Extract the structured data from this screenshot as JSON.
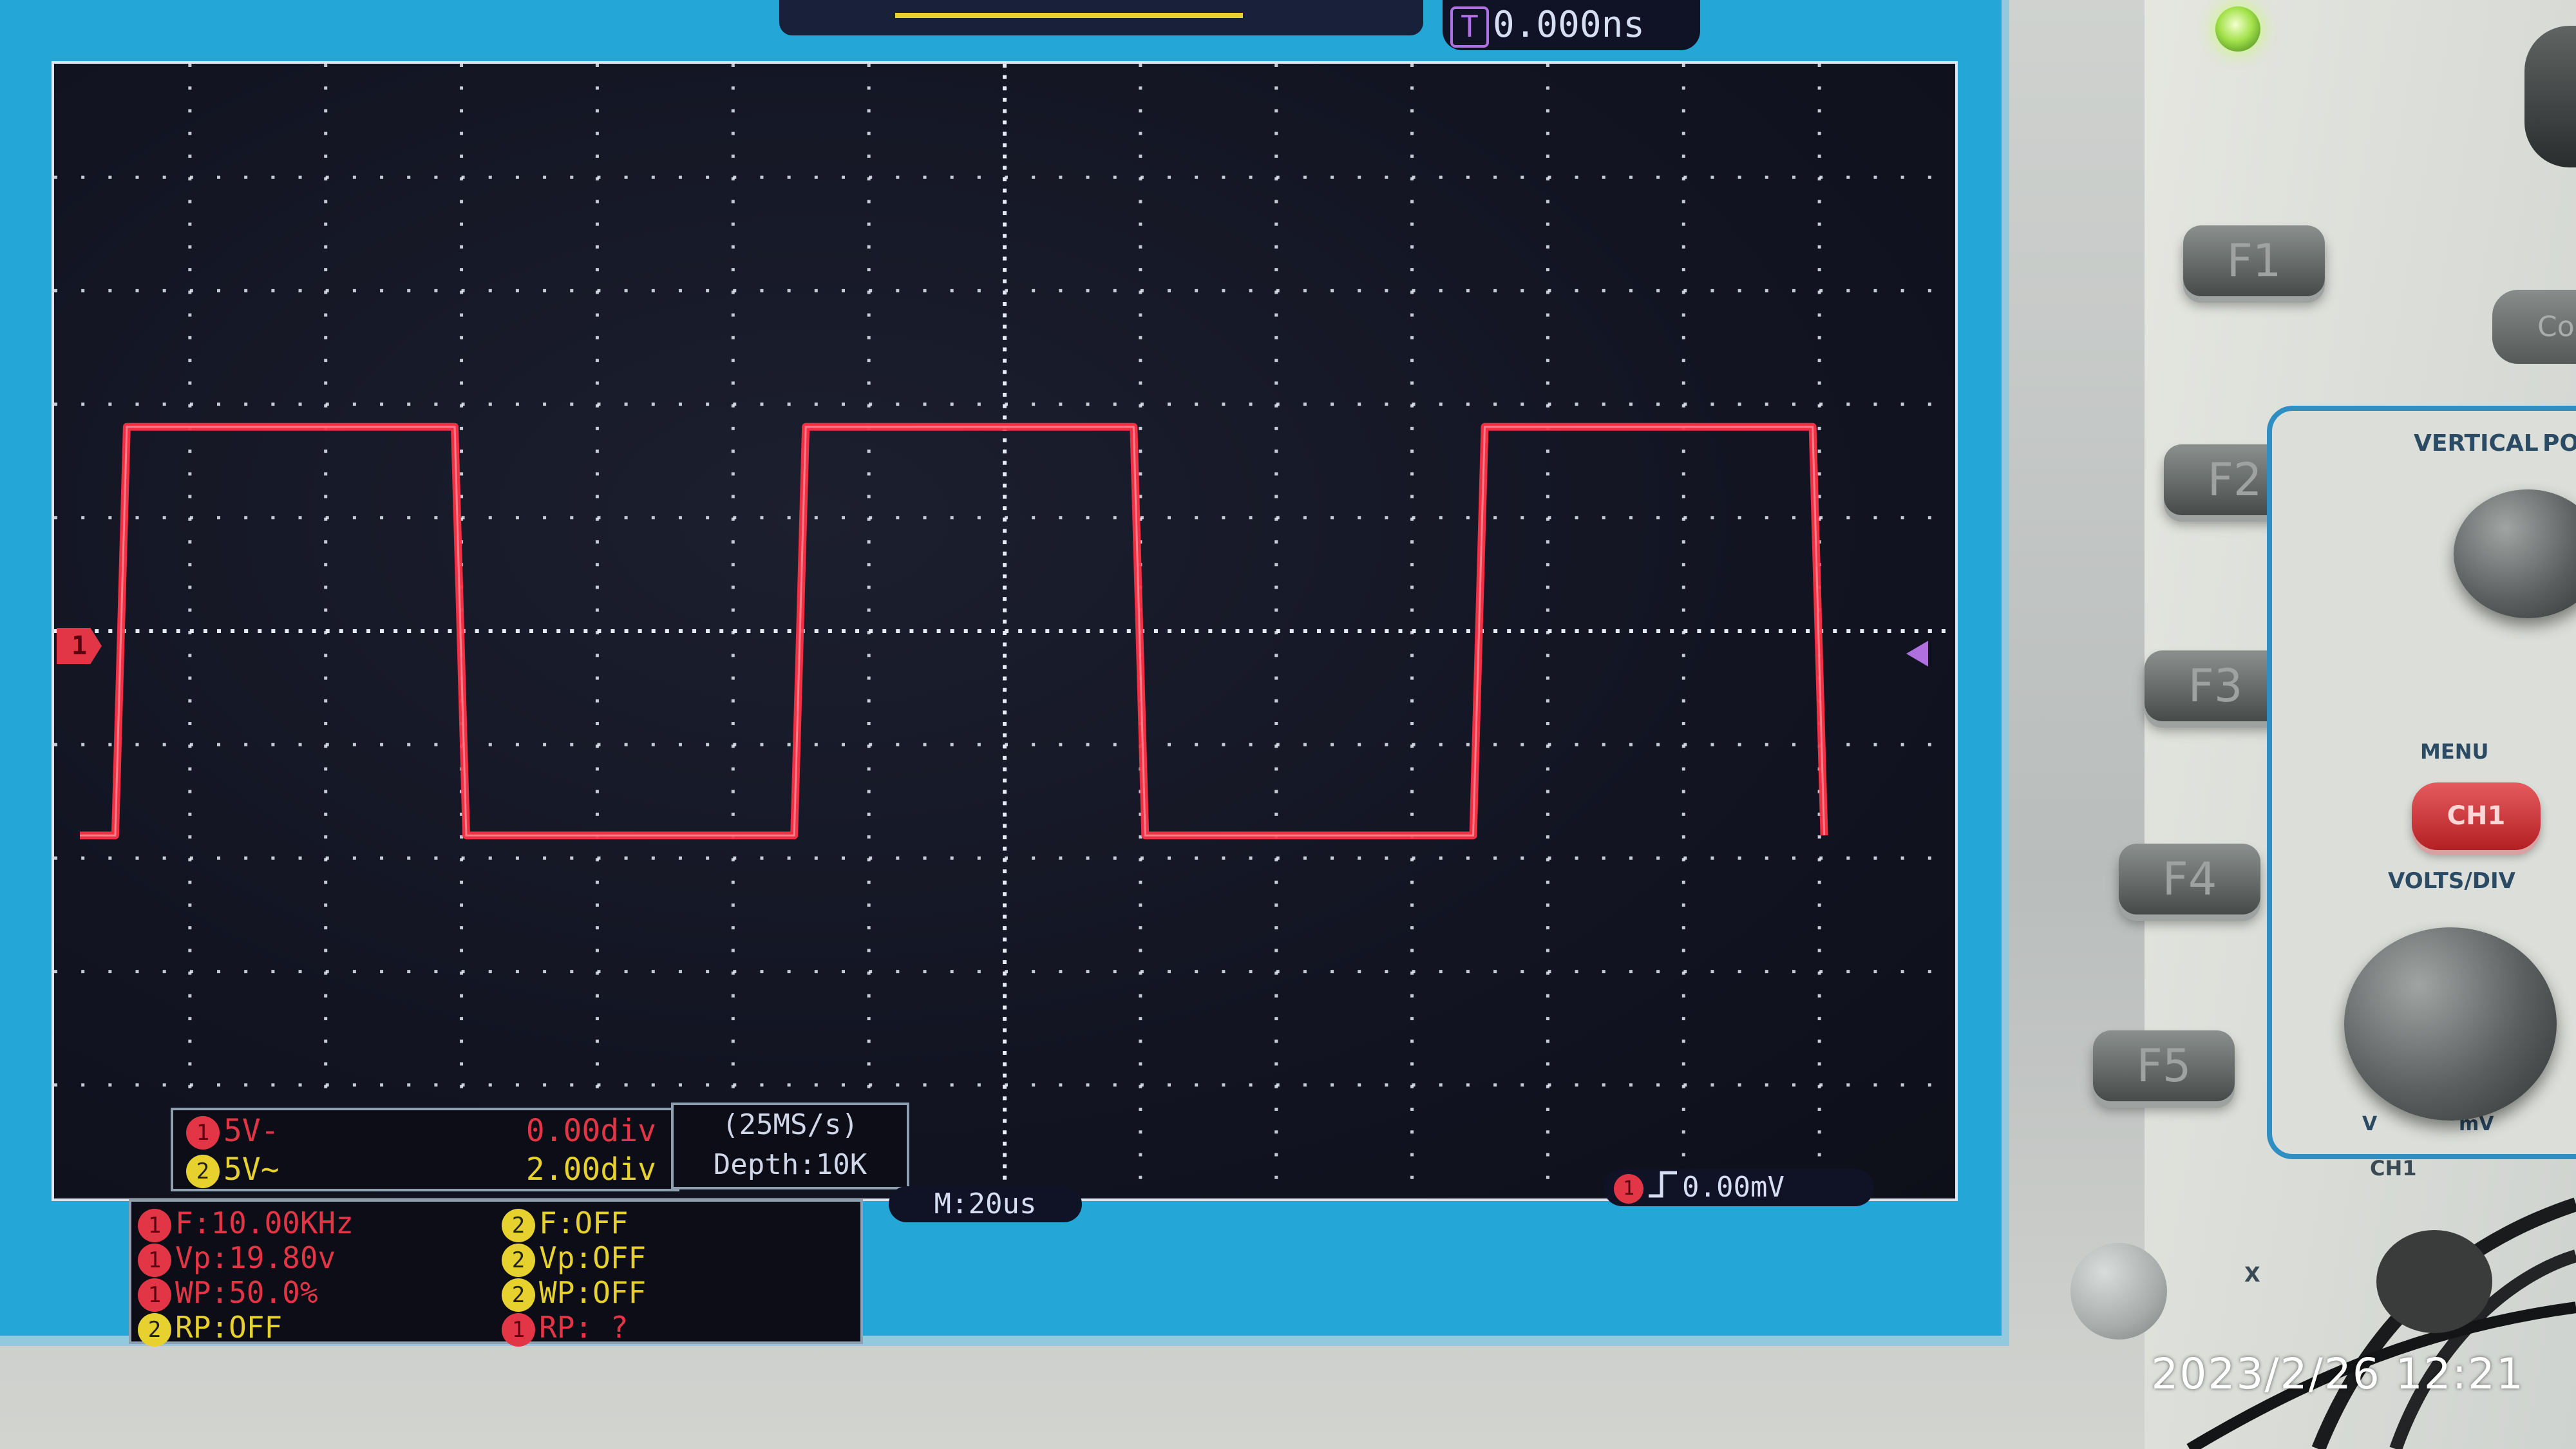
{
  "colors": {
    "lcd_frame": "#24a6d6",
    "screen_bg": "#121422",
    "trace": "#ff3046",
    "grid": "#e6eaf5",
    "ch1": "#e23546",
    "ch2": "#e6d12f",
    "readout_white": "#d7def2",
    "panel_accent": "#2f8ec2"
  },
  "trigger": {
    "position_label": "0.000ns",
    "t_marker_icon": "trigger-position-icon",
    "level_label": "0.00mV",
    "edge_icon": "rising-edge-icon"
  },
  "channel_marker": {
    "ch1_label": "1"
  },
  "channels": [
    {
      "id": "1",
      "scale": "5V-",
      "offset": "0.00div"
    },
    {
      "id": "2",
      "scale": "5V~",
      "offset": "2.00div"
    }
  ],
  "acquisition": {
    "sample_rate": "(25MS/s)",
    "depth": "Depth:10K"
  },
  "timebase": {
    "label": "M:20us"
  },
  "measurements": {
    "ch1": {
      "freq": "F:10.00KHz",
      "vp": "Vp:19.80v",
      "wp": "WP:50.0%"
    },
    "ch2": {
      "freq": "F:OFF",
      "vp": "Vp:OFF",
      "wp": "WP:OFF",
      "rp": "RP:OFF"
    },
    "rp_ch1": "RP: ?"
  },
  "chip_labels": {
    "ch1": "1",
    "ch2": "2"
  },
  "waveform": {
    "type": "square",
    "frequency": "10.00KHz",
    "duty_cycle_percent": 50.0
  },
  "controls": {
    "function_buttons": [
      "F1",
      "F2",
      "F3",
      "F4",
      "F5"
    ],
    "copy_label": "Cop",
    "vertical_label": "VERTICAL",
    "position_label": "POS",
    "menu_label": "MENU",
    "ch1_button": "CH1",
    "volts_div_label": "VOLTS/DIV",
    "ch1_input_label": "CH1",
    "x_label": "X",
    "knob_v_label": "V",
    "knob_mv_label": "mV"
  },
  "photo_timestamp": "2023/2/26 12:21"
}
